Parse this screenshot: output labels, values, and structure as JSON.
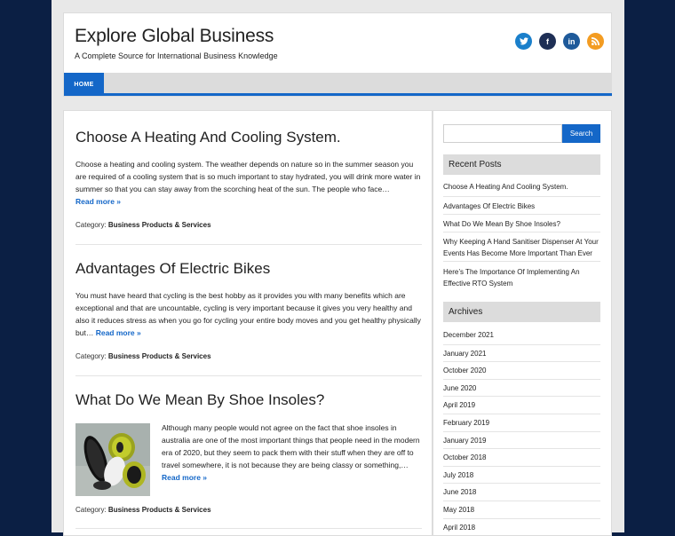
{
  "site": {
    "title": "Explore Global Business",
    "description": "A Complete Source for International Business Knowledge"
  },
  "social": {
    "twitter": "t",
    "facebook": "f",
    "linkedin": "in",
    "rss": "rss"
  },
  "nav": {
    "home": "HOME"
  },
  "posts": [
    {
      "title": "Choose A Heating And Cooling System.",
      "excerpt": "Choose a heating and cooling system. The weather depends on nature so in the summer season you are required of a cooling system that is so much important to stay hydrated, you will drink more water in summer so that you can stay away from the scorching heat of the sun. The people who face…",
      "read_more": "Read more »",
      "meta_label": "Category:",
      "category": "Business Products & Services"
    },
    {
      "title": "Advantages Of Electric Bikes",
      "excerpt": "You must have heard that cycling is the best hobby as it provides you with many benefits which are exceptional and that are uncountable, cycling is very important because it gives you very healthy and also it reduces stress as when you go for cycling your entire body moves and you get healthy physically but…",
      "read_more": "Read more »",
      "meta_label": "Category:",
      "category": "Business Products & Services"
    },
    {
      "title": "What Do We Mean By Shoe Insoles?",
      "excerpt": "Although many people would not agree on the fact that shoe insoles in australia are one of the most important things that people need in the modern era of 2020, but they seem to pack them with their stuff when they are off to travel somewhere, it is not because they are being classy or something,…",
      "read_more": "Read more »",
      "meta_label": "Category:",
      "category": "Business Products & Services"
    }
  ],
  "search": {
    "placeholder": "",
    "button": "Search"
  },
  "recent_posts": {
    "title": "Recent Posts",
    "items": [
      "Choose A Heating And Cooling System.",
      "Advantages Of Electric Bikes",
      "What Do We Mean By Shoe Insoles?",
      "Why Keeping A Hand Sanitiser Dispenser At Your Events Has Become More Important Than Ever",
      "Here’s The Importance Of Implementing An Effective RTO System"
    ]
  },
  "archives": {
    "title": "Archives",
    "items": [
      "December 2021",
      "January 2021",
      "October 2020",
      "June 2020",
      "April 2019",
      "February 2019",
      "January 2019",
      "October 2018",
      "July 2018",
      "June 2018",
      "May 2018",
      "April 2018"
    ]
  },
  "colors": {
    "accent": "#1467c8",
    "page_bg": "#0b1f44",
    "widget_bg": "#dcdcdc"
  }
}
